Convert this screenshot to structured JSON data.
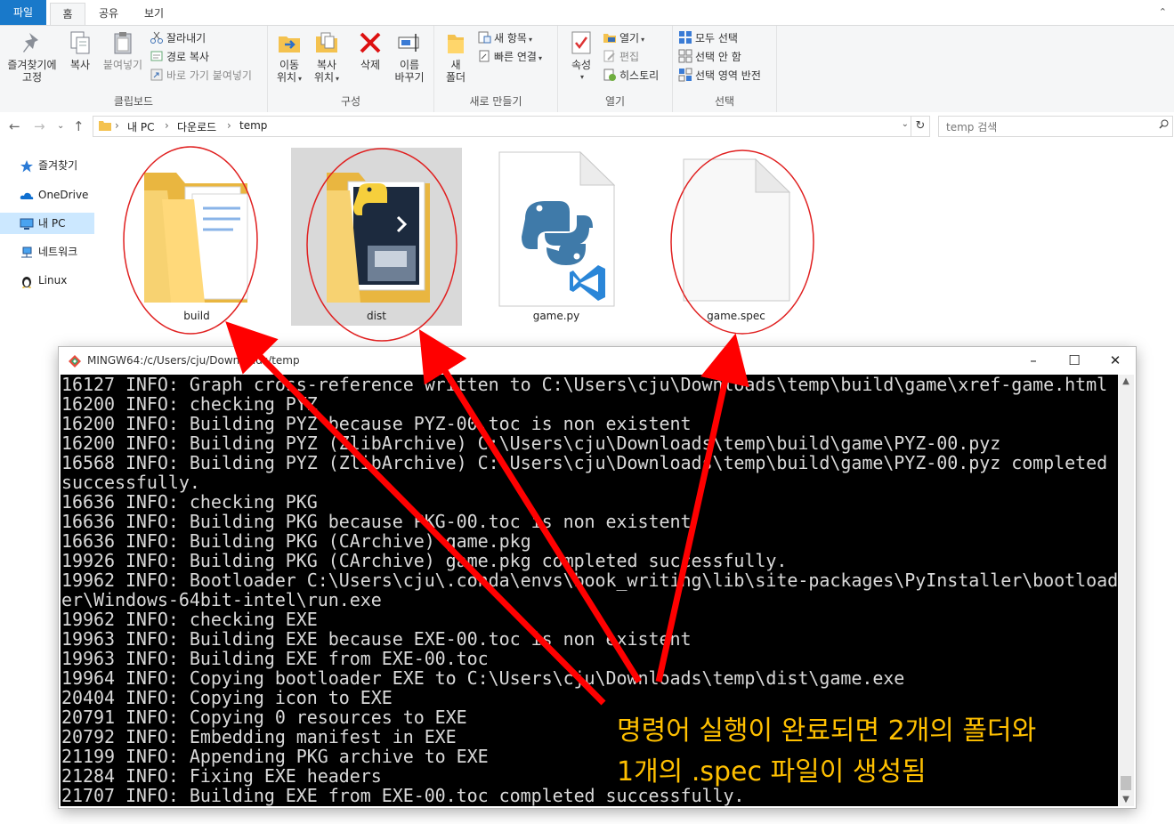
{
  "ribbon_tabs": {
    "file": "파일",
    "home": "홈",
    "share": "공유",
    "view": "보기"
  },
  "ribbon": {
    "clipboard": {
      "label": "클립보드",
      "pin": "즐겨찾기에",
      "pin2": "고정",
      "copy": "복사",
      "paste": "붙여넣기",
      "cut": "잘라내기",
      "copy_path": "경로 복사",
      "paste_shortcut": "바로 가기 붙여넣기"
    },
    "organize": {
      "label": "구성",
      "move_to": "이동",
      "move_to2": "위치",
      "copy_to": "복사",
      "copy_to2": "위치",
      "delete": "삭제",
      "rename": "이름",
      "rename2": "바꾸기"
    },
    "new": {
      "label": "새로 만들기",
      "new_folder": "새",
      "new_folder2": "폴더",
      "new_item": "새 항목",
      "easy_access": "빠른 연결"
    },
    "open": {
      "label": "열기",
      "properties": "속성",
      "open": "열기",
      "edit": "편집",
      "history": "히스토리"
    },
    "select": {
      "label": "선택",
      "select_all": "모두 선택",
      "select_none": "선택 안 함",
      "invert": "선택 영역 반전"
    }
  },
  "address": {
    "crumbs": [
      "내 PC",
      "다운로드",
      "temp"
    ],
    "search_placeholder": "temp 검색"
  },
  "nav_pane": {
    "items": [
      "즐겨찾기",
      "OneDrive -",
      "내 PC",
      "네트워크",
      "Linux"
    ]
  },
  "files": [
    {
      "name": "build",
      "icon": "folder-icon"
    },
    {
      "name": "dist",
      "icon": "folder-python-icon"
    },
    {
      "name": "game.py",
      "icon": "python-file-icon"
    },
    {
      "name": "game.spec",
      "icon": "blank-file-icon"
    }
  ],
  "terminal": {
    "title": "MINGW64:/c/Users/cju/Downloads/temp",
    "lines": [
      "16127 INFO: Graph cross-reference written to C:\\Users\\cju\\Downloads\\temp\\build\\game\\xref-game.html",
      "16200 INFO: checking PYZ",
      "16200 INFO: Building PYZ because PYZ-00.toc is non existent",
      "16200 INFO: Building PYZ (ZlibArchive) C:\\Users\\cju\\Downloads\\temp\\build\\game\\PYZ-00.pyz",
      "16568 INFO: Building PYZ (ZlibArchive) C:\\Users\\cju\\Downloads\\temp\\build\\game\\PYZ-00.pyz completed",
      "successfully.",
      "16636 INFO: checking PKG",
      "16636 INFO: Building PKG because PKG-00.toc is non existent",
      "16636 INFO: Building PKG (CArchive) game.pkg",
      "19926 INFO: Building PKG (CArchive) game.pkg completed successfully.",
      "19962 INFO: Bootloader C:\\Users\\cju\\.conda\\envs\\book_writing\\lib\\site-packages\\PyInstaller\\bootload",
      "er\\Windows-64bit-intel\\run.exe",
      "19962 INFO: checking EXE",
      "19963 INFO: Building EXE because EXE-00.toc is non existent",
      "19963 INFO: Building EXE from EXE-00.toc",
      "19964 INFO: Copying bootloader EXE to C:\\Users\\cju\\Downloads\\temp\\dist\\game.exe",
      "20404 INFO: Copying icon to EXE",
      "20791 INFO: Copying 0 resources to EXE",
      "20792 INFO: Embedding manifest in EXE",
      "21199 INFO: Appending PKG archive to EXE",
      "21284 INFO: Fixing EXE headers",
      "21707 INFO: Building EXE from EXE-00.toc completed successfully."
    ]
  },
  "annotation": {
    "line1": "명령어 실행이 완료되면 2개의 폴더와",
    "line2": "1개의 .spec 파일이 생성됨",
    "color": "#ffc000",
    "arrow_color": "#ff0000"
  }
}
